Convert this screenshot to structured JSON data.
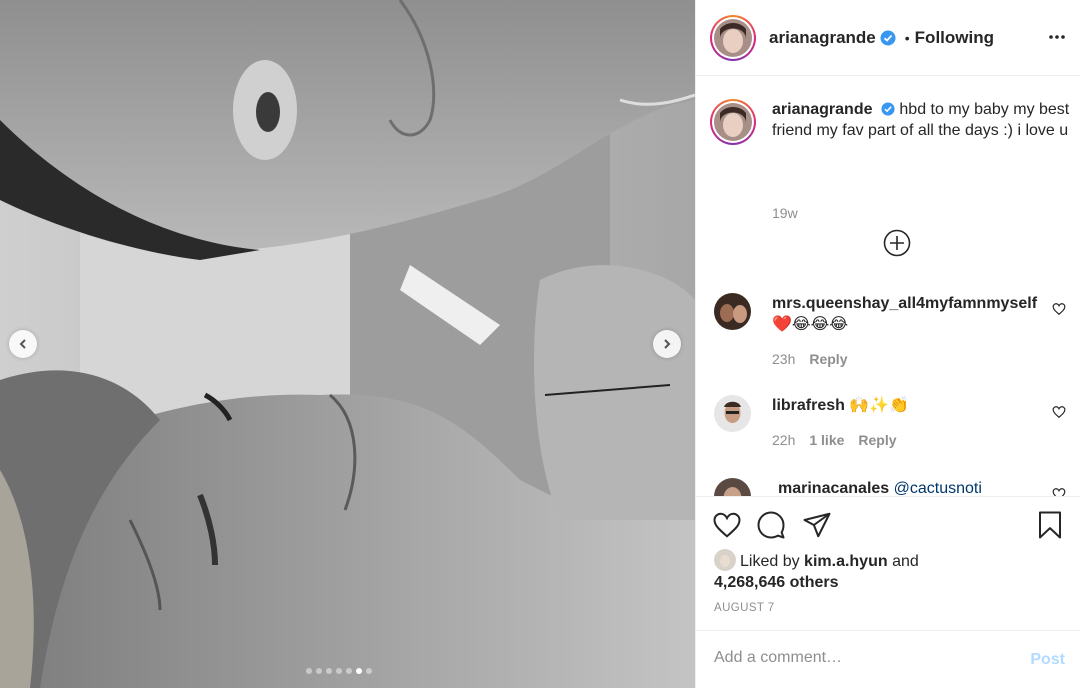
{
  "post": {
    "username": "arianagrande",
    "verified_icon": "verified-badge-icon",
    "following_label": "Following",
    "bullet": "•",
    "caption": "hbd to my baby my best friend my fav part of all the days :) i love u",
    "caption_time": "19w",
    "carousel_count": 7,
    "carousel_active_index": 5
  },
  "comments": [
    {
      "username": "mrs.queenshay_all4myfamnmyself",
      "text": "❤️😂😂😂",
      "time": "23h",
      "reply_label": "Reply"
    },
    {
      "username": "librafresh",
      "text": "🙌✨👏",
      "time": "22h",
      "likes_label": "1 like",
      "reply_label": "Reply"
    },
    {
      "username": "marinacanales",
      "text": "@cactusnoti"
    }
  ],
  "likes": {
    "prefix": "Liked by",
    "user": "kim.a.hyun",
    "and": "and",
    "others": "4,268,646 others"
  },
  "date": "AUGUST 7",
  "add_comment": {
    "placeholder": "Add a comment…",
    "post_label": "Post"
  },
  "colors": {
    "link_blue": "#0095f6",
    "post_disabled": "#b3dbff",
    "muted": "#8e8e8e",
    "text": "#262626"
  }
}
